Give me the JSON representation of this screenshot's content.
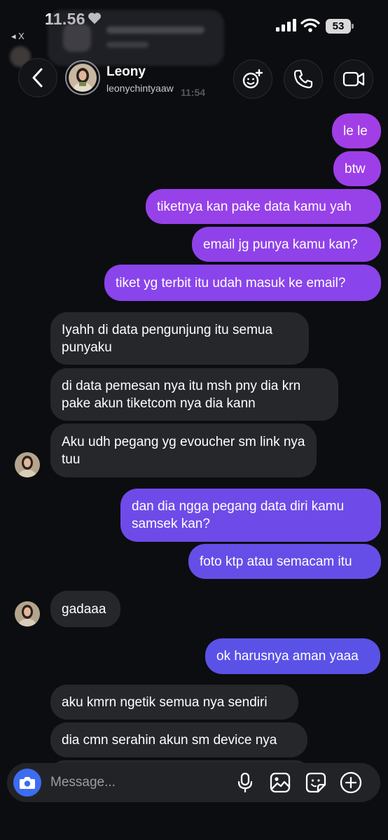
{
  "status": {
    "time": "11.56",
    "back_app": "◂ X",
    "battery": "53"
  },
  "header": {
    "name": "Leony",
    "handle": "leonychintyaaw"
  },
  "ghost": {
    "time": "11:54"
  },
  "messages": [
    {
      "side": "sent",
      "text": "le le",
      "color": "#a23ee6"
    },
    {
      "side": "sent",
      "text": "btw",
      "color": "#9d3fe8"
    },
    {
      "side": "sent",
      "text": "tiketnya kan pake data kamu yah",
      "color": "#9741e9"
    },
    {
      "side": "sent",
      "text": "email jg punya kamu kan?",
      "color": "#9042ea"
    },
    {
      "side": "sent",
      "text": "tiket yg terbit itu udah masuk ke email?",
      "color": "#8a44eb"
    },
    {
      "side": "recv",
      "text": "Iyahh di data pengunjung itu semua punyaku"
    },
    {
      "side": "recv",
      "text": "di data pemesan nya itu msh pny dia krn pake akun tiketcom nya dia kann"
    },
    {
      "side": "recv",
      "text": "Aku udh pegang yg evoucher sm link nya tuu"
    },
    {
      "side": "sent",
      "text": "dan dia ngga pegang data diri kamu samsek kan?",
      "color": "#6e4be9"
    },
    {
      "side": "sent",
      "text": "foto ktp atau semacam itu",
      "color": "#654ee8"
    },
    {
      "side": "recv",
      "text": "gadaaa"
    },
    {
      "side": "sent",
      "text": "ok harusnya aman yaaa",
      "color": "#5a52e7"
    },
    {
      "side": "recv",
      "text": "aku kmrn ngetik semua nya sendiri"
    },
    {
      "side": "recv",
      "text": "dia cmn serahin akun sm device nya"
    }
  ],
  "composer": {
    "placeholder": "Message..."
  },
  "colors": {
    "background": "#0c0d10",
    "received_bubble": "#26272b",
    "camera_button": "#3e6cf0"
  },
  "icons": [
    "heart-icon",
    "signal-icon",
    "wifi-icon",
    "battery-icon",
    "chevron-left-icon",
    "effects-icon",
    "phone-icon",
    "video-camera-icon",
    "camera-icon",
    "microphone-icon",
    "gallery-icon",
    "sticker-icon",
    "plus-circle-icon"
  ]
}
